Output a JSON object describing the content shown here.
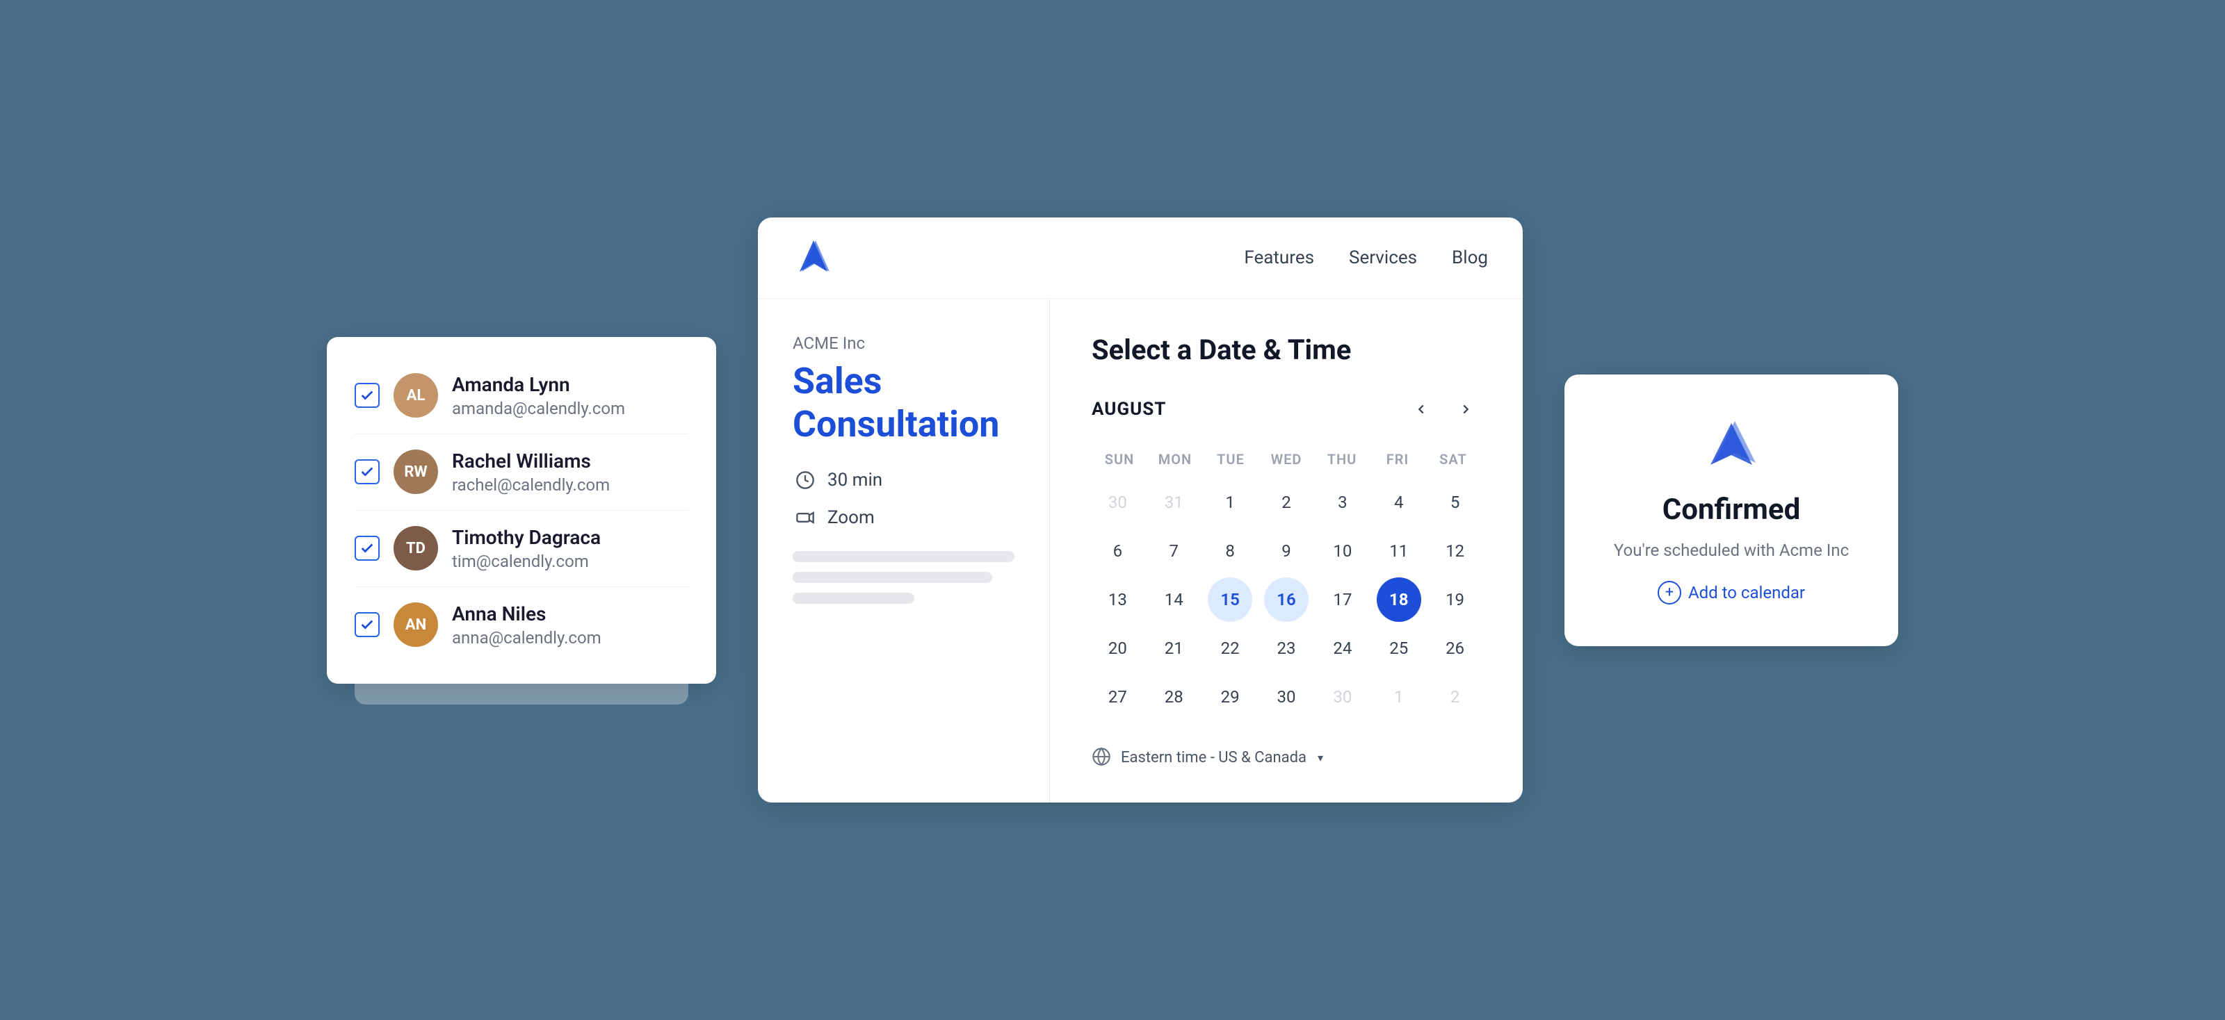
{
  "nav": {
    "features": "Features",
    "services": "Services",
    "blog": "Blog"
  },
  "users": [
    {
      "name": "Amanda Lynn",
      "email": "amanda@calendly.com",
      "color": "#a0522d",
      "initials": "AL"
    },
    {
      "name": "Rachel Williams",
      "email": "rachel@calendly.com",
      "color": "#8b5e3c",
      "initials": "RW"
    },
    {
      "name": "Timothy Dagraca",
      "email": "tim@calendly.com",
      "color": "#5c4033",
      "initials": "TD"
    },
    {
      "name": "Anna Niles",
      "email": "anna@calendly.com",
      "color": "#b87333",
      "initials": "AN"
    }
  ],
  "booking": {
    "company": "ACME Inc",
    "service": "Sales Consultation",
    "duration": "30 min",
    "platform": "Zoom",
    "calendar_title": "Select a Date & Time",
    "month": "AUGUST",
    "days_header": [
      "SUN",
      "MON",
      "TUE",
      "WED",
      "THU",
      "FRI",
      "SAT"
    ],
    "weeks": [
      [
        {
          "day": "30",
          "type": "other-month"
        },
        {
          "day": "31",
          "type": "other-month"
        },
        {
          "day": "1",
          "type": "normal"
        },
        {
          "day": "2",
          "type": "normal"
        },
        {
          "day": "3",
          "type": "normal"
        },
        {
          "day": "4",
          "type": "normal"
        },
        {
          "day": "5",
          "type": "normal"
        }
      ],
      [
        {
          "day": "6",
          "type": "normal"
        },
        {
          "day": "7",
          "type": "normal"
        },
        {
          "day": "8",
          "type": "normal"
        },
        {
          "day": "9",
          "type": "normal"
        },
        {
          "day": "10",
          "type": "normal"
        },
        {
          "day": "11",
          "type": "normal"
        },
        {
          "day": "12",
          "type": "normal"
        }
      ],
      [
        {
          "day": "13",
          "type": "normal"
        },
        {
          "day": "14",
          "type": "normal"
        },
        {
          "day": "15",
          "type": "highlighted"
        },
        {
          "day": "16",
          "type": "highlighted"
        },
        {
          "day": "17",
          "type": "normal"
        },
        {
          "day": "18",
          "type": "selected"
        },
        {
          "day": "19",
          "type": "normal"
        }
      ],
      [
        {
          "day": "20",
          "type": "normal"
        },
        {
          "day": "21",
          "type": "normal"
        },
        {
          "day": "22",
          "type": "normal"
        },
        {
          "day": "23",
          "type": "normal"
        },
        {
          "day": "24",
          "type": "normal"
        },
        {
          "day": "25",
          "type": "normal"
        },
        {
          "day": "26",
          "type": "normal"
        }
      ],
      [
        {
          "day": "27",
          "type": "normal"
        },
        {
          "day": "28",
          "type": "normal"
        },
        {
          "day": "29",
          "type": "normal"
        },
        {
          "day": "30",
          "type": "normal"
        },
        {
          "day": "30",
          "type": "other-month"
        },
        {
          "day": "1",
          "type": "other-month"
        },
        {
          "day": "2",
          "type": "other-month"
        }
      ]
    ],
    "timezone": "Eastern time - US & Canada"
  },
  "confirmed": {
    "title": "Confirmed",
    "subtitle": "You're scheduled with Acme Inc",
    "add_calendar": "Add to calendar"
  }
}
